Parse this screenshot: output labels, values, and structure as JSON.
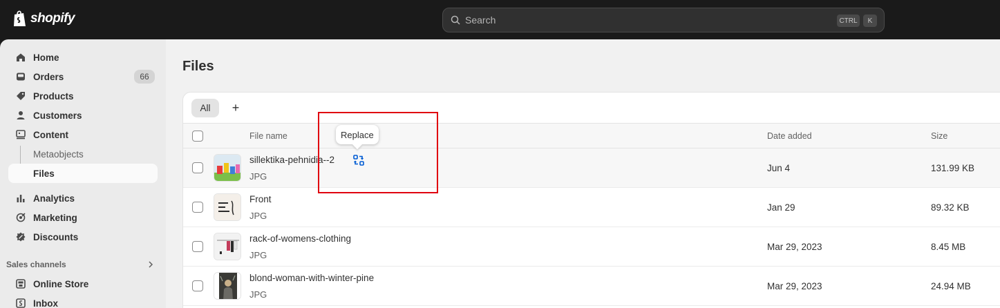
{
  "app": {
    "brand": "shopify"
  },
  "search": {
    "placeholder": "Search",
    "shortcut_ctrl": "CTRL",
    "shortcut_key": "K"
  },
  "sidebar": {
    "items": [
      {
        "label": "Home",
        "icon": "home-icon"
      },
      {
        "label": "Orders",
        "icon": "inbox-icon",
        "badge": "66"
      },
      {
        "label": "Products",
        "icon": "tag-icon"
      },
      {
        "label": "Customers",
        "icon": "person-icon"
      },
      {
        "label": "Content",
        "icon": "image-icon"
      },
      {
        "label": "Metaobjects"
      },
      {
        "label": "Files",
        "active": true
      },
      {
        "label": "Analytics",
        "icon": "chart-icon"
      },
      {
        "label": "Marketing",
        "icon": "target-icon"
      },
      {
        "label": "Discounts",
        "icon": "discount-icon"
      }
    ],
    "sales_channels_label": "Sales channels",
    "channels": [
      {
        "label": "Online Store",
        "icon": "store-icon"
      },
      {
        "label": "Inbox",
        "icon": "inbox-channel-icon"
      }
    ]
  },
  "page": {
    "title": "Files"
  },
  "tabs": {
    "all": "All",
    "add": "+"
  },
  "table": {
    "headers": {
      "file_name": "File name",
      "date_added": "Date added",
      "size": "Size"
    },
    "rows": [
      {
        "name": "sillektika-pehnidia--2",
        "type": "JPG",
        "date": "Jun 4",
        "size": "131.99 KB"
      },
      {
        "name": "Front",
        "type": "JPG",
        "date": "Jan 29",
        "size": "89.32 KB"
      },
      {
        "name": "rack-of-womens-clothing",
        "type": "JPG",
        "date": "Mar 29, 2023",
        "size": "8.45 MB"
      },
      {
        "name": "blond-woman-with-winter-pine",
        "type": "JPG",
        "date": "Mar 29, 2023",
        "size": "24.94 MB"
      }
    ]
  },
  "tooltip": {
    "label": "Replace"
  },
  "colors": {
    "accent": "#005bd3",
    "highlight": "#e0000f",
    "topbar": "#1a1a1a"
  }
}
